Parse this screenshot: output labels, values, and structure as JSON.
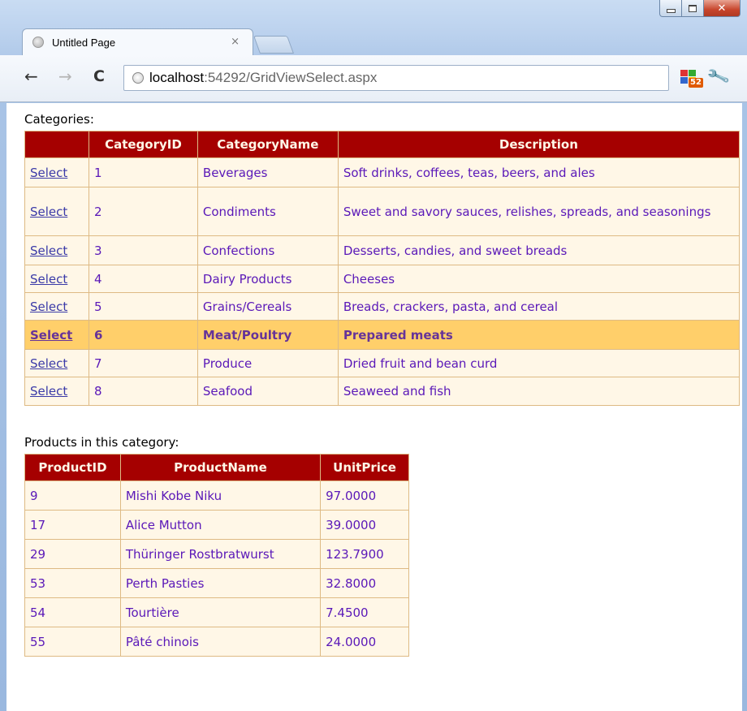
{
  "browser": {
    "tab_title": "Untitled Page",
    "tab_close": "×",
    "url_host": "localhost",
    "url_rest": ":54292/GridViewSelect.aspx",
    "extension_badge": "52"
  },
  "categories": {
    "caption": "Categories:",
    "headers": [
      "",
      "CategoryID",
      "CategoryName",
      "Description"
    ],
    "select_label": "Select",
    "selected_index": 5,
    "rows": [
      {
        "id": "1",
        "name": "Beverages",
        "description": "Soft drinks, coffees, teas, beers, and ales"
      },
      {
        "id": "2",
        "name": "Condiments",
        "description": "Sweet and savory sauces, relishes, spreads, and seasonings"
      },
      {
        "id": "3",
        "name": "Confections",
        "description": "Desserts, candies, and sweet breads"
      },
      {
        "id": "4",
        "name": "Dairy Products",
        "description": "Cheeses"
      },
      {
        "id": "5",
        "name": "Grains/Cereals",
        "description": "Breads, crackers, pasta, and cereal"
      },
      {
        "id": "6",
        "name": "Meat/Poultry",
        "description": "Prepared meats"
      },
      {
        "id": "7",
        "name": "Produce",
        "description": "Dried fruit and bean curd"
      },
      {
        "id": "8",
        "name": "Seafood",
        "description": "Seaweed and fish"
      }
    ]
  },
  "products": {
    "caption": "Products in this category:",
    "headers": [
      "ProductID",
      "ProductName",
      "UnitPrice"
    ],
    "rows": [
      {
        "id": "9",
        "name": "Mishi Kobe Niku",
        "price": "97.0000"
      },
      {
        "id": "17",
        "name": "Alice Mutton",
        "price": "39.0000"
      },
      {
        "id": "29",
        "name": "Thüringer Rostbratwurst",
        "price": "123.7900"
      },
      {
        "id": "53",
        "name": "Perth Pasties",
        "price": "32.8000"
      },
      {
        "id": "54",
        "name": "Tourtière",
        "price": "7.4500"
      },
      {
        "id": "55",
        "name": "Pâté chinois",
        "price": "24.0000"
      }
    ]
  },
  "colors": {
    "header_bg": "#a50000",
    "header_fg": "#fff7e7",
    "row_bg": "#fff7e7",
    "selected_row_bg": "#ffcf6a",
    "border": "#deba84"
  }
}
